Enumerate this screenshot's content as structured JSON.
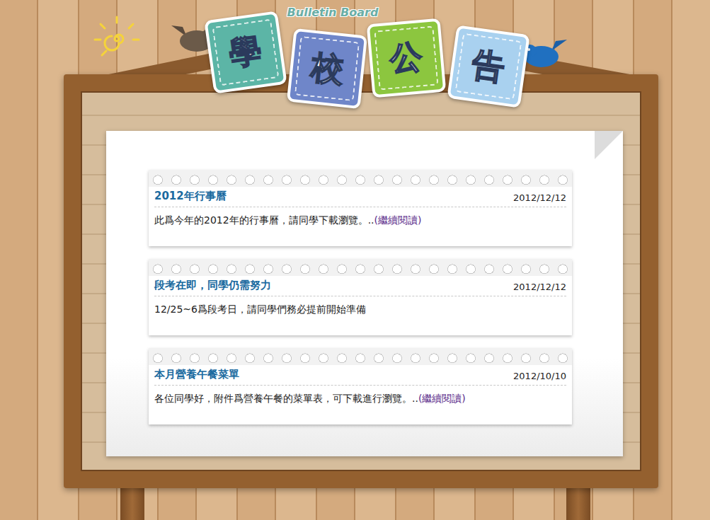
{
  "header": {
    "subtitle": "Bulletin Board",
    "tiles": [
      {
        "char": "學",
        "color": "#5cb5a6"
      },
      {
        "char": "校",
        "color": "#6f86c9"
      },
      {
        "char": "公",
        "color": "#8cc63f"
      },
      {
        "char": "告",
        "color": "#a9d1ef"
      }
    ]
  },
  "notices": [
    {
      "title": "2012年行事曆",
      "date": "2012/12/12",
      "body": "此爲今年的2012年的行事曆，請同學下載瀏覽。..",
      "more": "(繼續閱讀)"
    },
    {
      "title": "段考在即，同學仍需努力",
      "date": "2012/12/12",
      "body": "12/25~6爲段考日，請同學們務必提前開始準備"
    },
    {
      "title": "本月營養午餐菜單",
      "date": "2012/10/10",
      "body": "各位同學好，附件爲營養午餐的菜單表，可下載進行瀏覽。..",
      "more": "(繼續閱讀)"
    }
  ]
}
